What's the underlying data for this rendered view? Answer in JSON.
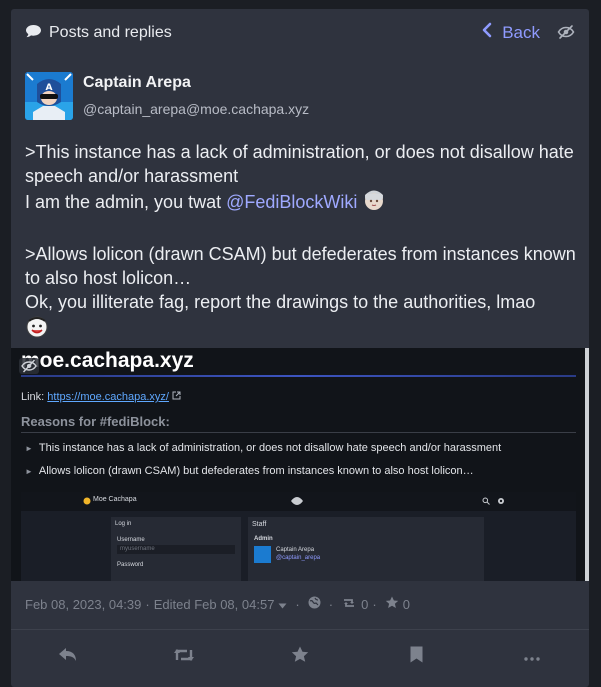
{
  "header": {
    "title": "Posts and replies",
    "back_label": "Back"
  },
  "post": {
    "author_name": "Captain Arepa",
    "author_handle": "@captain_arepa@moe.cachapa.xyz",
    "paragraph1_line1": ">This instance has a lack of administration, or does not disallow hate speech and/or harassment",
    "paragraph1_line2": "I am the admin, you twat ",
    "mention": "@FediBlockWiki",
    "paragraph2_line1": ">Allows lolicon (drawn CSAM) but defederates from instances known to also host lolicon…",
    "paragraph2_line2": "Ok, you illiterate fag, report the drawings to the authorities, lmao",
    "timestamp": "Feb 08, 2023, 04:39",
    "edited": "Edited Feb 08, 04:57",
    "reblogs": "0",
    "favourites": "0"
  },
  "attachment": {
    "domain": "moe.cachapa.xyz",
    "link_prefix": "Link: ",
    "link_url": "https://moe.cachapa.xyz/",
    "reasons_heading": "Reasons for #fediBlock:",
    "reason1": "This instance has a lack of administration, or does not disallow hate speech and/or harassment",
    "reason2": "Allows lolicon (drawn CSAM) but defederates from instances known to also host lolicon…",
    "inner_brand": "Moe Cachapa",
    "inner_login": "Log in",
    "inner_username_label": "Username",
    "inner_username_placeholder": "myusername",
    "inner_password_label": "Password",
    "inner_staff": "Staff",
    "inner_admin": "Admin",
    "inner_admin_name": "Captain Arepa",
    "inner_admin_handle": "@captain_arepa"
  },
  "icons": {
    "title": "speech-bubble-icon",
    "back": "chevron-left-icon",
    "hide": "eye-slash-icon",
    "visibility": "globe-icon",
    "reply": "reply-icon",
    "repeat": "retweet-icon",
    "favourite": "star-icon",
    "bookmark": "bookmark-icon",
    "more": "ellipsis-icon"
  },
  "colors": {
    "accent": "#8f9bff",
    "panel": "#2f333e",
    "background": "#1b1e24"
  }
}
